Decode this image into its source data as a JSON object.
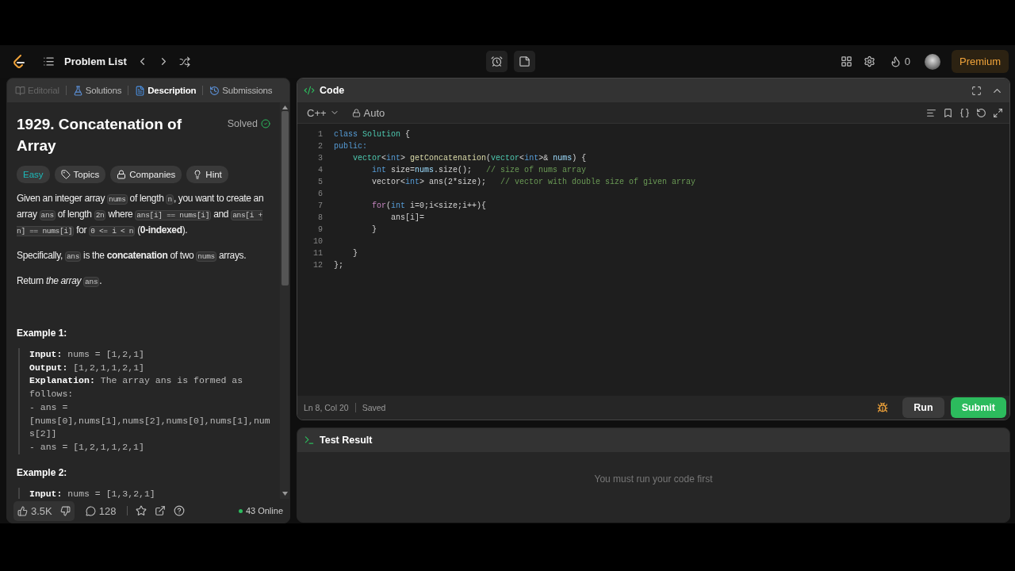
{
  "navbar": {
    "title": "Problem List",
    "streak": "0",
    "premium": "Premium"
  },
  "description_tabs": [
    {
      "label": "Editorial",
      "kind": "book",
      "selected": false,
      "disabled": true
    },
    {
      "label": "Solutions",
      "kind": "flask",
      "selected": false,
      "disabled": false
    },
    {
      "label": "Description",
      "kind": "document",
      "selected": true,
      "disabled": false
    },
    {
      "label": "Submissions",
      "kind": "history",
      "selected": false,
      "disabled": false
    }
  ],
  "problem": {
    "title": "1929. Concatenation of Array",
    "status": "Solved",
    "difficulty": "Easy",
    "tags": [
      {
        "label": "Topics",
        "kind": "tag"
      },
      {
        "label": "Companies",
        "kind": "lock"
      },
      {
        "label": "Hint",
        "kind": "bulb"
      }
    ],
    "paragraphs": [
      [
        {
          "text": "Given an integer array ",
          "kind": "text"
        },
        {
          "text": "nums",
          "kind": "code"
        },
        {
          "text": " of length ",
          "kind": "text"
        },
        {
          "text": "n",
          "kind": "code"
        },
        {
          "text": ", you want to create an array ",
          "kind": "text"
        },
        {
          "text": "ans",
          "kind": "code"
        },
        {
          "text": " of length ",
          "kind": "text"
        },
        {
          "text": "2n",
          "kind": "code"
        },
        {
          "text": " where ",
          "kind": "text"
        },
        {
          "text": "ans[i] == nums[i]",
          "kind": "code"
        },
        {
          "text": " and ",
          "kind": "text"
        },
        {
          "text": "ans[i + n] == nums[i]",
          "kind": "code"
        },
        {
          "text": " for ",
          "kind": "text"
        },
        {
          "text": "0 <= i < n",
          "kind": "code"
        },
        {
          "text": " (",
          "kind": "text"
        },
        {
          "text": "0-indexed",
          "kind": "bold"
        },
        {
          "text": ").",
          "kind": "text"
        }
      ],
      [
        {
          "text": "Specifically, ",
          "kind": "text"
        },
        {
          "text": "ans",
          "kind": "code"
        },
        {
          "text": " is the ",
          "kind": "text"
        },
        {
          "text": "concatenation",
          "kind": "bold"
        },
        {
          "text": " of two ",
          "kind": "text"
        },
        {
          "text": "nums",
          "kind": "code"
        },
        {
          "text": " arrays.",
          "kind": "text"
        }
      ],
      [
        {
          "text": "Return ",
          "kind": "text"
        },
        {
          "text": "the array ",
          "kind": "italic"
        },
        {
          "text": "ans",
          "kind": "code"
        },
        {
          "text": ".",
          "kind": "text"
        }
      ]
    ],
    "examples": [
      {
        "title": "Example 1:",
        "lines": [
          {
            "label": "Input:",
            "value": "nums = [1,2,1]"
          },
          {
            "label": "Output:",
            "value": "[1,2,1,1,2,1]"
          },
          {
            "label": "Explanation:",
            "value": "The array ans is formed as follows:\n- ans = [nums[0],nums[1],nums[2],nums[0],nums[1],nums[2]]\n- ans = [1,2,1,1,2,1]"
          }
        ]
      },
      {
        "title": "Example 2:",
        "lines": [
          {
            "label": "Input:",
            "value": "nums = [1,3,2,1]"
          }
        ]
      }
    ]
  },
  "footer": {
    "likes": "3.5K",
    "comments": "128",
    "online": "43 Online"
  },
  "code_panel": {
    "title": "Code",
    "language": "C++",
    "mode": "Auto",
    "lines": [
      {
        "number": "1",
        "tokens": [
          {
            "text": "class ",
            "kind": "keyword"
          },
          {
            "text": "Solution",
            "kind": "type"
          },
          {
            "text": " {",
            "kind": "plain"
          }
        ]
      },
      {
        "number": "2",
        "tokens": [
          {
            "text": "public:",
            "kind": "keyword"
          }
        ]
      },
      {
        "number": "3",
        "tokens": [
          {
            "text": "    vector",
            "kind": "type"
          },
          {
            "text": "<",
            "kind": "plain"
          },
          {
            "text": "int",
            "kind": "keyword"
          },
          {
            "text": "> ",
            "kind": "plain"
          },
          {
            "text": "getConcatenation",
            "kind": "function"
          },
          {
            "text": "(",
            "kind": "plain"
          },
          {
            "text": "vector",
            "kind": "type"
          },
          {
            "text": "<",
            "kind": "plain"
          },
          {
            "text": "int",
            "kind": "keyword"
          },
          {
            "text": ">& ",
            "kind": "plain"
          },
          {
            "text": "nums",
            "kind": "variable"
          },
          {
            "text": ") {",
            "kind": "plain"
          }
        ]
      },
      {
        "number": "4",
        "tokens": [
          {
            "text": "        int",
            "kind": "keyword"
          },
          {
            "text": " size=",
            "kind": "plain"
          },
          {
            "text": "nums",
            "kind": "variable"
          },
          {
            "text": ".size();   ",
            "kind": "plain"
          },
          {
            "text": "// size of nums array",
            "kind": "comment"
          }
        ]
      },
      {
        "number": "5",
        "tokens": [
          {
            "text": "        vector<",
            "kind": "plain"
          },
          {
            "text": "int",
            "kind": "keyword"
          },
          {
            "text": "> ans(2*size);   ",
            "kind": "plain"
          },
          {
            "text": "// vector with double size of given array",
            "kind": "comment"
          }
        ]
      },
      {
        "number": "6"
      },
      {
        "number": "7",
        "tokens": [
          {
            "text": "        for",
            "kind": "control"
          },
          {
            "text": "(",
            "kind": "plain"
          },
          {
            "text": "int",
            "kind": "keyword"
          },
          {
            "text": " i=0;i<size;i++){",
            "kind": "plain"
          }
        ]
      },
      {
        "number": "8",
        "tokens": [
          {
            "text": "            ans[i]=",
            "kind": "plain"
          }
        ]
      },
      {
        "number": "9",
        "tokens": [
          {
            "text": "        }",
            "kind": "plain"
          }
        ]
      },
      {
        "number": "10"
      },
      {
        "number": "11",
        "tokens": [
          {
            "text": "    }",
            "kind": "plain"
          }
        ]
      },
      {
        "number": "12",
        "tokens": [
          {
            "text": "};",
            "kind": "plain"
          }
        ]
      }
    ],
    "status": {
      "position": "Ln 8, Col 20",
      "saved": "Saved"
    },
    "run": "Run",
    "submit": "Submit"
  },
  "test_result": {
    "title": "Test Result",
    "message": "You must run your code first"
  }
}
